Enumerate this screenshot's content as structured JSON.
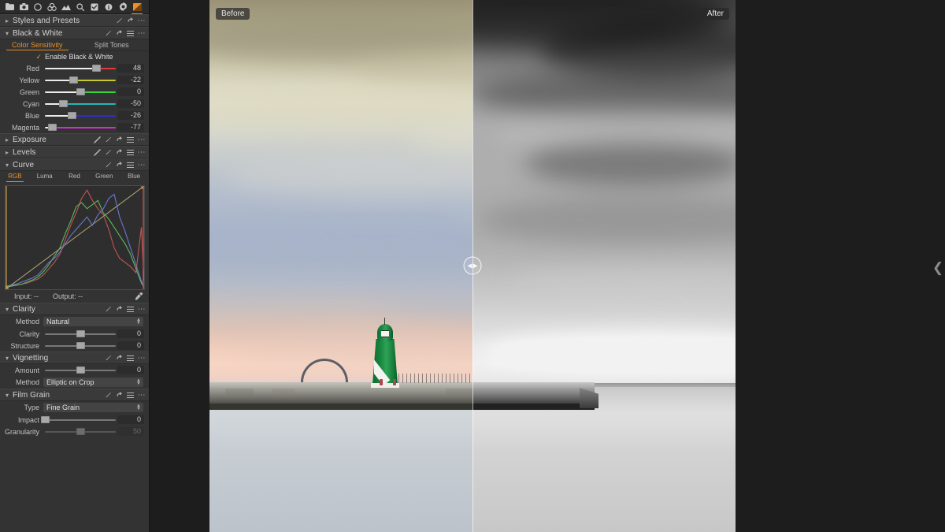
{
  "toolbar": {
    "icons": [
      {
        "name": "library-folder-icon",
        "glyph": "folder"
      },
      {
        "name": "camera-icon",
        "glyph": "camera"
      },
      {
        "name": "circle-icon",
        "glyph": "circle"
      },
      {
        "name": "layers-icon",
        "glyph": "layers"
      },
      {
        "name": "landscape-icon",
        "glyph": "landscape"
      },
      {
        "name": "search-icon",
        "glyph": "search"
      },
      {
        "name": "checkbox-icon",
        "glyph": "checkbox"
      },
      {
        "name": "info-icon",
        "glyph": "info"
      },
      {
        "name": "gear-icon",
        "glyph": "gear"
      },
      {
        "name": "gradient-tool-icon",
        "glyph": "gradient",
        "active": true
      }
    ]
  },
  "sections": {
    "styles_presets": {
      "title": "Styles and Presets",
      "expanded": false
    },
    "black_white": {
      "title": "Black & White",
      "expanded": true,
      "tabs": [
        {
          "label": "Color Sensitivity",
          "selected": true
        },
        {
          "label": "Split Tones",
          "selected": false
        }
      ],
      "enable_label": "Enable Black & White",
      "enable_checked": true,
      "sliders": [
        {
          "label": "Red",
          "value": "48",
          "pos": 71,
          "color": "#e03a3a"
        },
        {
          "label": "Yellow",
          "value": "-22",
          "pos": 40,
          "color": "#c8c82a"
        },
        {
          "label": "Green",
          "value": "0",
          "pos": 50,
          "color": "#3ad23a"
        },
        {
          "label": "Cyan",
          "value": "-50",
          "pos": 27,
          "color": "#27b5b5"
        },
        {
          "label": "Blue",
          "value": "-26",
          "pos": 38,
          "color": "#2a2ae6"
        },
        {
          "label": "Magenta",
          "value": "-77",
          "pos": 12,
          "color": "#d62ad6"
        }
      ]
    },
    "exposure": {
      "title": "Exposure",
      "expanded": false
    },
    "levels": {
      "title": "Levels",
      "expanded": false
    },
    "curve": {
      "title": "Curve",
      "expanded": true,
      "channel_tabs": [
        {
          "label": "RGB",
          "selected": true
        },
        {
          "label": "Luma",
          "selected": false
        },
        {
          "label": "Red",
          "selected": false
        },
        {
          "label": "Green",
          "selected": false
        },
        {
          "label": "Blue",
          "selected": false
        }
      ],
      "input_label": "Input:",
      "input_value": "--",
      "output_label": "Output:",
      "output_value": "--"
    },
    "clarity": {
      "title": "Clarity",
      "expanded": true,
      "method_label": "Method",
      "method_value": "Natural",
      "sliders": [
        {
          "label": "Clarity",
          "value": "0",
          "pos": 50
        },
        {
          "label": "Structure",
          "value": "0",
          "pos": 50
        }
      ]
    },
    "vignetting": {
      "title": "Vignetting",
      "expanded": true,
      "sliders": [
        {
          "label": "Amount",
          "value": "0",
          "pos": 50
        }
      ],
      "method_label": "Method",
      "method_value": "Elliptic on Crop"
    },
    "film_grain": {
      "title": "Film Grain",
      "expanded": true,
      "type_label": "Type",
      "type_value": "Fine Grain",
      "sliders": [
        {
          "label": "Impact",
          "value": "0",
          "pos": 2,
          "dim": false
        },
        {
          "label": "Granularity",
          "value": "50",
          "pos": 50,
          "dim": true
        }
      ]
    }
  },
  "viewer": {
    "before_label": "Before",
    "after_label": "After",
    "split_handle_name": "before-after-split-handle",
    "collapse_chevron": "❮"
  },
  "colors": {
    "accent": "#e8912a",
    "panel_bg": "#333333",
    "app_bg": "#1d1d1d",
    "header_bg": "#3a3a3a",
    "text": "#d4d4d4"
  },
  "chart_data": {
    "type": "line",
    "title": "Curve",
    "xlabel": "Input",
    "ylabel": "Output",
    "xlim": [
      0,
      255
    ],
    "ylim": [
      0,
      255
    ],
    "grid": false,
    "legend": "none",
    "series": [
      {
        "name": "Curve",
        "color": "#cfc28a",
        "x": [
          0,
          255
        ],
        "y": [
          0,
          255
        ]
      },
      {
        "name": "Red histogram",
        "color": "#d05a5a",
        "x": [
          0,
          10,
          20,
          30,
          40,
          50,
          60,
          70,
          80,
          90,
          100,
          110,
          120,
          130,
          140,
          150,
          160,
          170,
          180,
          190,
          200,
          210,
          220,
          230,
          240,
          250,
          255
        ],
        "y": [
          2,
          3,
          4,
          5,
          6,
          8,
          10,
          14,
          20,
          26,
          34,
          48,
          62,
          74,
          88,
          96,
          86,
          78,
          72,
          58,
          40,
          30,
          26,
          22,
          16,
          60,
          8
        ]
      },
      {
        "name": "Green histogram",
        "color": "#63c763",
        "x": [
          0,
          10,
          20,
          30,
          40,
          50,
          60,
          70,
          80,
          90,
          100,
          110,
          120,
          130,
          140,
          150,
          160,
          170,
          180,
          190,
          200,
          210,
          220,
          230,
          240,
          250,
          255
        ],
        "y": [
          2,
          3,
          4,
          5,
          7,
          9,
          12,
          17,
          24,
          32,
          40,
          54,
          66,
          80,
          84,
          78,
          82,
          86,
          74,
          68,
          60,
          52,
          44,
          34,
          20,
          6,
          2
        ]
      },
      {
        "name": "Blue histogram",
        "color": "#6f7ee0",
        "x": [
          0,
          10,
          20,
          30,
          40,
          50,
          60,
          70,
          80,
          90,
          100,
          110,
          120,
          130,
          140,
          150,
          160,
          170,
          180,
          190,
          200,
          210,
          220,
          230,
          240,
          250,
          255
        ],
        "y": [
          3,
          4,
          5,
          7,
          9,
          11,
          14,
          20,
          26,
          30,
          36,
          44,
          52,
          58,
          64,
          70,
          62,
          72,
          78,
          88,
          92,
          70,
          56,
          40,
          24,
          8,
          2
        ]
      }
    ]
  }
}
